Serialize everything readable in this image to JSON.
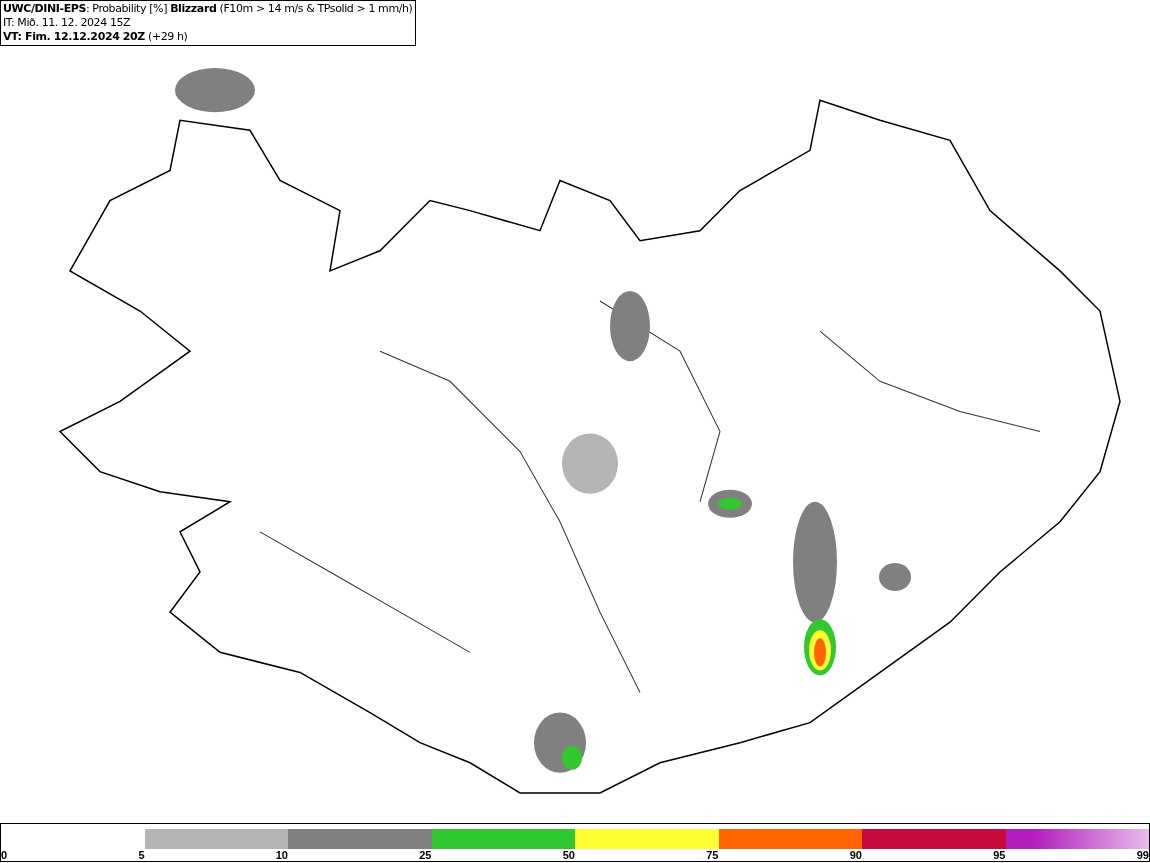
{
  "header": {
    "title": "**UWC/DINI-EPS**: Probability [%] **Blizzard** (F10m > 14 m/s & TPsolid > 1 mm/h)",
    "initial_time": "IT: Mið. 11. 12. 2024 15Z",
    "valid_time": "**VT: Fim. 12.12.2024 20Z** (+29 h)"
  },
  "legend": {
    "segments": [
      {
        "kind": "empty"
      },
      {
        "kind": "solid",
        "color": "#b4b4b4"
      },
      {
        "kind": "solid",
        "color": "#808080"
      },
      {
        "kind": "solid",
        "color": "#32c832"
      },
      {
        "kind": "solid",
        "color": "#ffff32"
      },
      {
        "kind": "solid",
        "color": "#ff6400"
      },
      {
        "kind": "solid",
        "color": "#c80a3c"
      },
      {
        "kind": "gradient",
        "color": "#b41ebe"
      }
    ],
    "ticks": [
      "0",
      "5",
      "10",
      "25",
      "50",
      "75",
      "90",
      "95",
      "99"
    ]
  }
}
